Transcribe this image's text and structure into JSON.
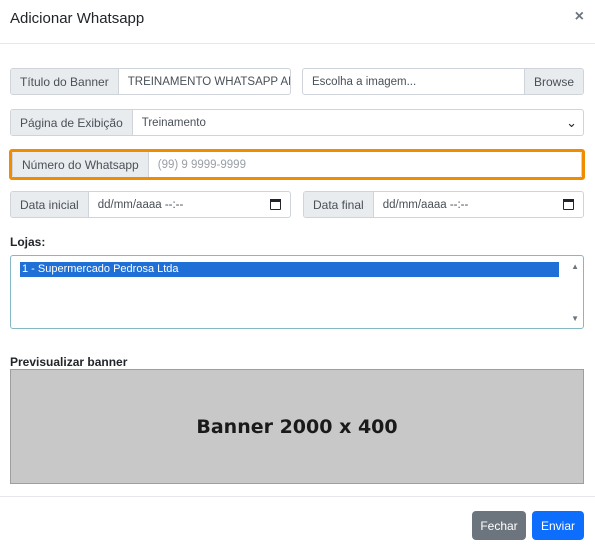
{
  "modal": {
    "title": "Adicionar Whatsapp",
    "close_symbol": "×"
  },
  "form": {
    "titulo_label": "Título do Banner",
    "titulo_value": "TREINAMENTO WHATSAPP APLICATIVO",
    "image_placeholder": "Escolha a imagem...",
    "browse_label": "Browse",
    "pagina_label": "Página de Exibição",
    "pagina_value": "Treinamento",
    "numero_label": "Número do Whatsapp",
    "numero_placeholder": "(99) 9 9999-9999",
    "data_inicial_label": "Data inicial",
    "data_inicial_value": "dd/mm/aaaa --:--",
    "data_final_label": "Data final",
    "data_final_value": "dd/mm/aaaa --:--",
    "lojas_label": "Lojas:",
    "lojas_options": [
      "1 - Supermercado Pedrosa Ltda"
    ],
    "preview_label": "Previsualizar banner",
    "banner_text": "Banner 2000 x 400"
  },
  "footer": {
    "fechar_label": "Fechar",
    "enviar_label": "Enviar"
  },
  "colors": {
    "highlight": "#f08c00",
    "primary": "#0d6efd",
    "secondary": "#6c757d",
    "selected_option": "#1f6fd6"
  },
  "icons": [
    "close-icon",
    "chevron-down-icon",
    "calendar-icon",
    "scroll-up-icon",
    "scroll-down-icon"
  ]
}
